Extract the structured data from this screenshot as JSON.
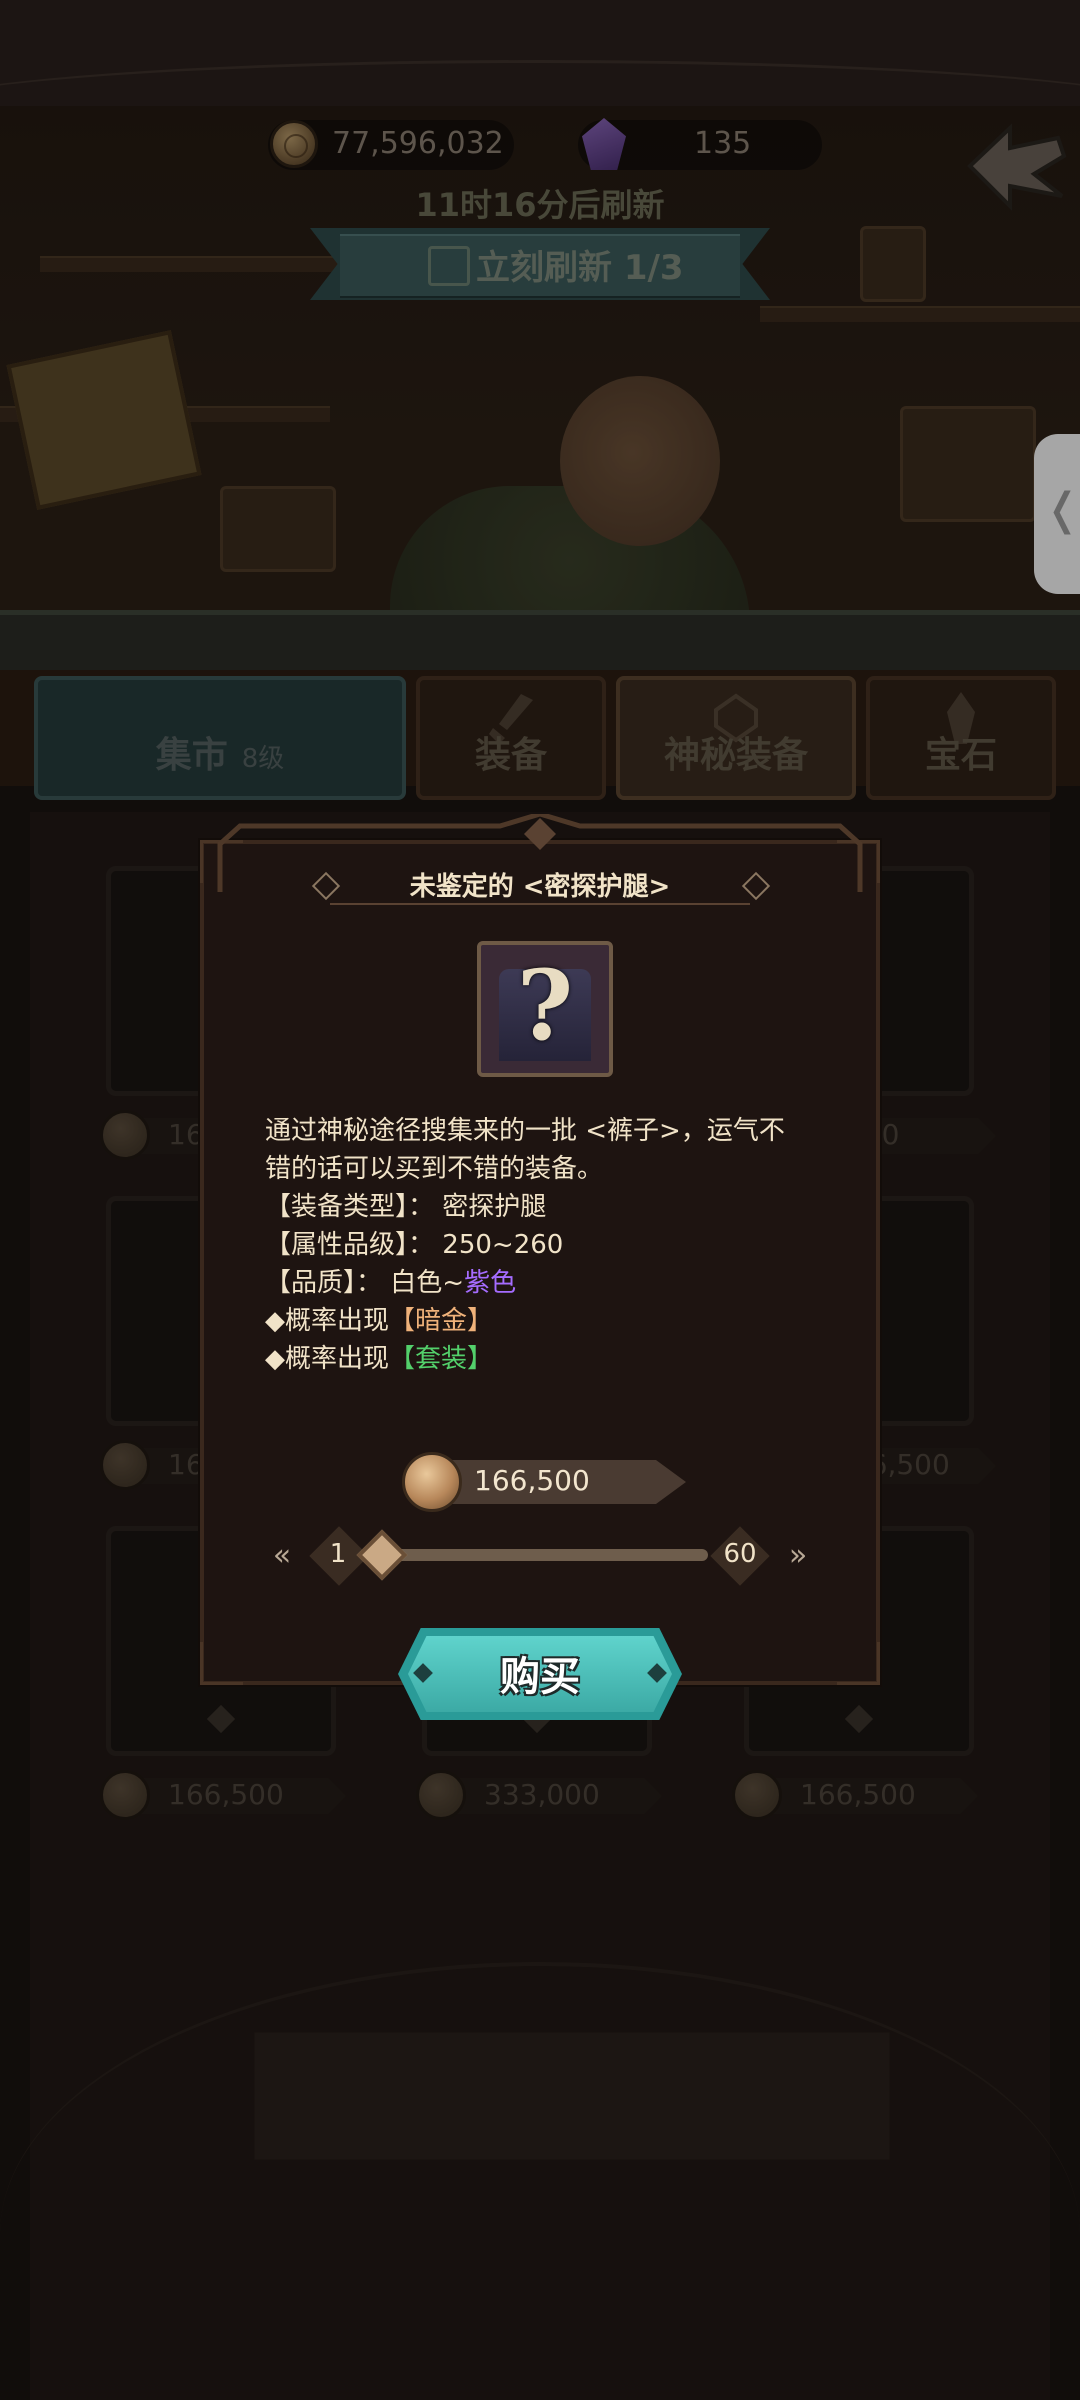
{
  "topbar": {
    "coins": "77,596,032",
    "gems": "135"
  },
  "refresh": {
    "timer": "11时16分后刷新",
    "button_label": "立刻刷新 1/3"
  },
  "tabs": [
    {
      "label": "集市",
      "sub": "8级"
    },
    {
      "label": "装备"
    },
    {
      "label": "神秘装备"
    },
    {
      "label": "宝石"
    }
  ],
  "grid": {
    "prices": [
      "16",
      "",
      "750",
      "166,500",
      "",
      "166,500",
      "166,500",
      "333,000",
      "166,500"
    ]
  },
  "modal": {
    "title": "未鉴定的 <密探护腿>",
    "icon": "unknown-item-icon",
    "desc": {
      "line1": "通过神秘途径搜集来的一批 <裤子>，运气不",
      "line2": "错的话可以买到不错的装备。",
      "type_label": "【装备类型】：",
      "type_value": "密探护腿",
      "level_label": "【属性品级】：",
      "level_value": "250~260",
      "quality_label": "【品质】：",
      "quality_white": "白色~",
      "quality_purple": "紫色",
      "chance_prefix": "◆概率出现",
      "chance1": "【暗金】",
      "chance2": "【套装】"
    },
    "price": "166,500",
    "qty_min": "1",
    "qty_max": "60",
    "qty_current": 1,
    "buy_label": "购买"
  },
  "colors": {
    "accent_teal": "#3caaa5",
    "purple": "#a56cff",
    "gold": "#f0b27a",
    "green": "#53d06b"
  }
}
